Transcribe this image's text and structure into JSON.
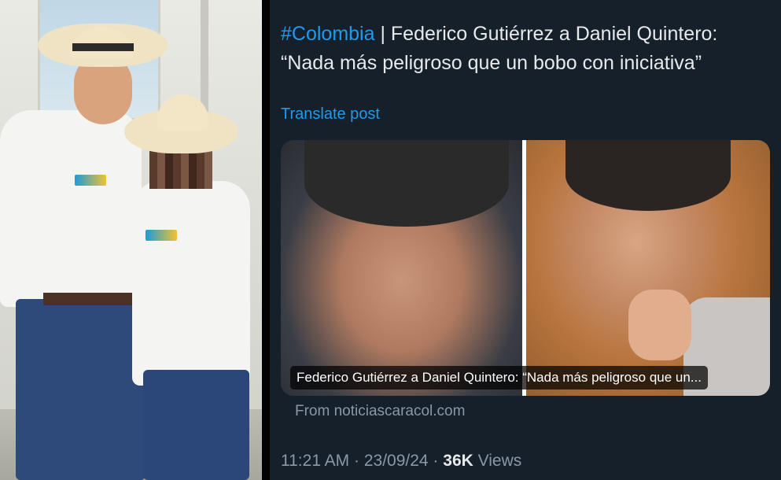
{
  "tweet": {
    "hashtag": "#Colombia",
    "separator": " | ",
    "text_line1": "Federico Gutiérrez a Daniel Quintero:",
    "text_line2": "“Nada más peligroso que un bobo con iniciativa”",
    "translate_label": "Translate post",
    "card_caption": "Federico Gutiérrez a Daniel Quintero: “Nada más peligroso que un...",
    "card_source": "From noticiascaracol.com",
    "time": "11:21 AM",
    "dot1": " · ",
    "date": "23/09/24",
    "dot2": " · ",
    "views_count": "36K",
    "views_label": " Views"
  },
  "colors": {
    "background": "#15202b",
    "text": "#e7e9ea",
    "accent": "#1d9bf0",
    "secondary": "#8b98a5"
  }
}
